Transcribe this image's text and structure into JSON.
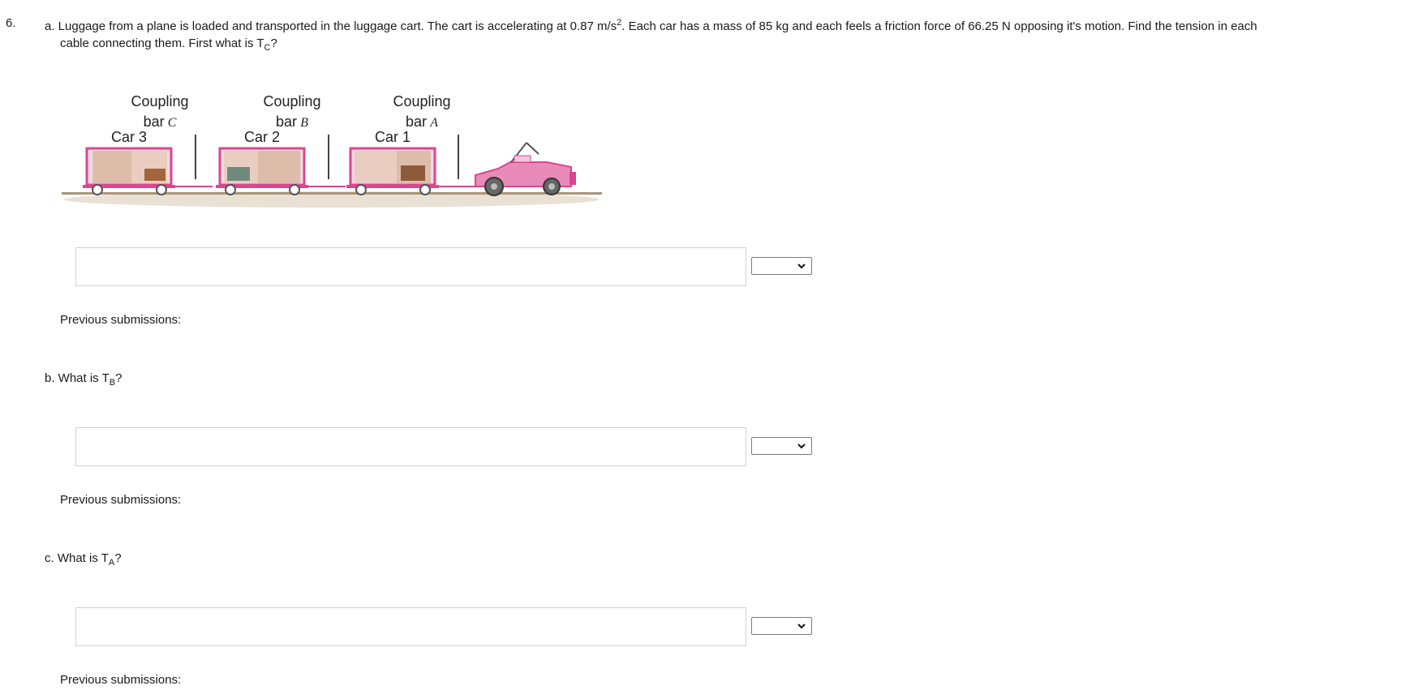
{
  "question": {
    "number": "6.",
    "part_a": {
      "prefix": "a. Luggage from a plane is loaded and transported in the luggage cart. The cart is accelerating at 0.87 m/s",
      "sup": "2",
      "mid": ". Each car has a mass of 85 kg and each feels a friction force of 66.25 N opposing it's motion. Find the tension in each",
      "line2_prefix": "cable connecting them. First what is T",
      "line2_sub": "C",
      "line2_suffix": "?"
    },
    "part_b": {
      "prefix": "b. What is T",
      "sub": "B",
      "suffix": "?"
    },
    "part_c": {
      "prefix": "c. What is T",
      "sub": "A",
      "suffix": "?"
    }
  },
  "figure": {
    "coupling_c": {
      "line1": "Coupling",
      "line2": "bar",
      "letter": "C"
    },
    "coupling_b": {
      "line1": "Coupling",
      "line2": "bar",
      "letter": "B"
    },
    "coupling_a": {
      "line1": "Coupling",
      "line2": "bar",
      "letter": "A"
    },
    "car3": "Car 3",
    "car2": "Car 2",
    "car1": "Car 1"
  },
  "answers": [
    {
      "value": "",
      "unit_selected": ""
    },
    {
      "value": "",
      "unit_selected": ""
    },
    {
      "value": "",
      "unit_selected": ""
    }
  ],
  "previous_submissions_label": "Previous submissions:",
  "colors": {
    "cart_pink": "#d9478f",
    "cargo_tan": "#d7b79b",
    "ground": "#c9bca8"
  }
}
